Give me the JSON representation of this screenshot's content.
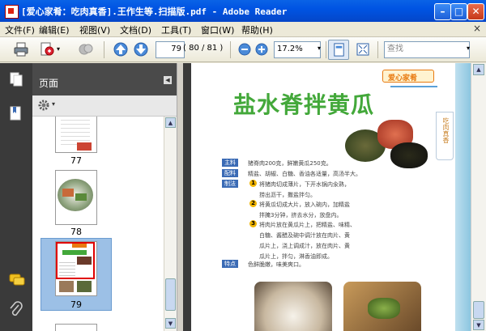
{
  "window": {
    "title": "[爱心家肴：吃肉真香].王作生等.扫描版.pdf - Adobe Reader"
  },
  "menu": {
    "items": [
      "文件(F)",
      "编辑(E)",
      "视图(V)",
      "文档(D)",
      "工具(T)",
      "窗口(W)",
      "帮助(H)"
    ],
    "close_glyph": "×"
  },
  "toolbar": {
    "page_number": "79",
    "page_count": "( 80 / 81 )",
    "zoom": "17.2%",
    "search_placeholder": "查找"
  },
  "nav": {
    "title": "页面",
    "thumbnails": [
      {
        "label": "77"
      },
      {
        "label": "78"
      },
      {
        "label": "79",
        "selected": true
      }
    ]
  },
  "document": {
    "header_badge": "爱心家肴",
    "title": "盐水脊拌黄瓜",
    "side_label": "吃肉真香",
    "sections": [
      {
        "tag": "主料",
        "text": "猪脊肉200克，鲜嫩黄瓜250克。"
      },
      {
        "tag": "配料",
        "text": "精盐、胡椒、白糖、香油各适量，高汤半大。"
      },
      {
        "tag": "制法",
        "text": "将猪肉切成薄片，下开水锅内汆熟，"
      },
      {
        "tag": "",
        "text": "捞出沥干，撒盐拌匀。"
      },
      {
        "tag": "",
        "text": "将黄瓜切成大片，放入碗内，加精盐"
      },
      {
        "tag": "",
        "text": "拌腌3分钟，挤去水分，放盘内。"
      },
      {
        "tag": "",
        "text": "将肉片放在黄瓜片上，把精盐、味精、"
      },
      {
        "tag": "",
        "text": "白糖、酱醋及碗中调汁放在肉片、黄"
      },
      {
        "tag": "",
        "text": "瓜片上，浇上调成汁，放在肉片、黄"
      },
      {
        "tag": "",
        "text": "瓜片上，拌匀，淋香油即成。"
      },
      {
        "tag": "特点",
        "text": "色鲜脆嫩，味美爽口。"
      }
    ],
    "step_numbers": [
      "1",
      "2",
      "3"
    ]
  },
  "colors": {
    "title_green": "#43a83a",
    "tag_blue": "#3b6bb5",
    "badge_orange": "#e87a10",
    "selection_red": "#e00000",
    "titlebar_blue": "#0054e3"
  }
}
